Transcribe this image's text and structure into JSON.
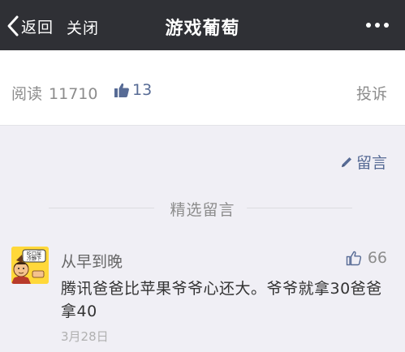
{
  "nav": {
    "back_label": "返回",
    "close_label": "关闭",
    "title": "游戏葡萄",
    "more_icon": "more-dots-icon"
  },
  "stats": {
    "read_label": "阅读",
    "read_count": "11710",
    "like_count": "13",
    "report_label": "投诉"
  },
  "comments": {
    "write_label": "留言",
    "section_label": "精选留言",
    "items": [
      {
        "name": "从早到晚",
        "likes": "66",
        "text": "腾讯爸爸比苹果爷爷心还大。爷爷就拿30爸爸拿40",
        "date": "3月28日",
        "avatar_text": "吃口屎冷静下"
      }
    ]
  },
  "colors": {
    "nav_bg": "#2f3035",
    "link_blue": "#576b95",
    "page_bg": "#f0eff5",
    "avatar_bg": "#ffd83a"
  }
}
